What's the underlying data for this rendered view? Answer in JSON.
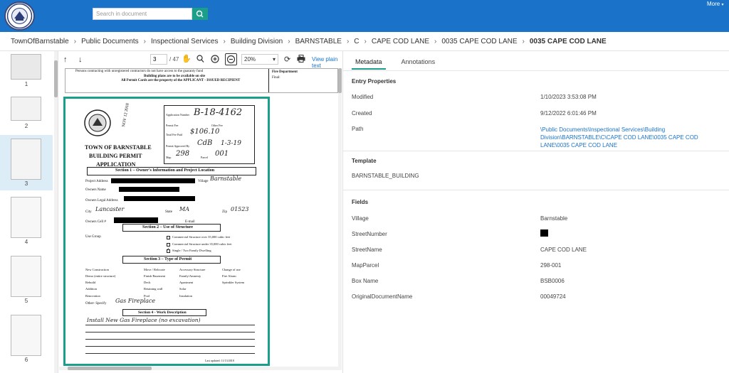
{
  "header": {
    "search_placeholder": "Search in document",
    "more_label": "More",
    "seal_text": "TOWN OF BARNSTABLE"
  },
  "breadcrumbs": [
    "TownOfBarnstable",
    "Public Documents",
    "Inspectional Services",
    "Building Division",
    "BARNSTABLE",
    "C",
    "CAPE COD LANE",
    "0035 CAPE COD LANE",
    "0035 CAPE COD LANE"
  ],
  "thumbnails": [
    "1",
    "2",
    "3",
    "4",
    "5",
    "6"
  ],
  "toolbar": {
    "page_value": "3",
    "page_total": "/ 47",
    "zoom_value": "20%",
    "plain_text_label": "View plain text"
  },
  "page1": {
    "line1": "Persons contracting with unregistered contractors do not have access to the guaranty fund",
    "line2": "Building plans are to be available on site",
    "line3": "All Permit Cards are the property of the APPLICANT - ISSUED RECIPIENT",
    "fire": "Fire Department",
    "final": "Final:"
  },
  "form": {
    "seal": "TOWN OF BARNSTABLE",
    "stamp1": "TOWN OF",
    "stamp2": "BARNSTABLE",
    "stamp3": "NOV 12 2018",
    "title1": "TOWN OF BARNSTABLE",
    "title2": "BUILDING PERMIT",
    "title3": "APPLICATION",
    "app_num_label": "Application Number",
    "app_num": "B-18-4162",
    "permit_fee": "Permit Fee",
    "other_fee": "Other Fee",
    "total_fee_label": "Total Fee Paid",
    "total_fee": "$106.10",
    "approved_label": "Permit Approved By",
    "approved": "CdB",
    "approved_date": "1-3-19",
    "map_label": "Map",
    "map": "298",
    "parcel_label": "Parcel",
    "parcel": "001",
    "s1": "Section 1 – Owner's Information and Project Location",
    "project_addr": "Project Address",
    "village_label": "Village",
    "village": "Barnstable",
    "owners_name": "Owners Name",
    "owners_legal": "Owners Legal Address",
    "city_label": "City",
    "city": "Lancaster",
    "state_label": "State",
    "state": "MA",
    "zip_label": "Zip",
    "zip": "01523",
    "cell_label": "Owners Cell #",
    "email_label": "E-mail",
    "s2": "Section 2 – Use of Structure",
    "use_group": "Use Group",
    "use1": "Commercial Structure over 35,000 cubic feet",
    "use2": "Commercial Structure under 35,000 cubic feet",
    "use3": "Single / Two Family Dwelling",
    "s3": "Section 3 – Type of Permit",
    "types": [
      "New Construction",
      "Move / Relocate",
      "Accessory Structure",
      "Change of use",
      "Demo (entire structure)",
      "Finish Basement",
      "Family/Amnesty",
      "Fire Alarm",
      "Rebuild",
      "Deck",
      "Apartment",
      "Sprinkler System",
      "Addition",
      "Retaining wall",
      "Solar",
      "Renovation",
      "Pool",
      "Insulation"
    ],
    "other_label": "Other- Specify",
    "other_value": "Gas Fireplace",
    "s4": "Section 4 - Work Description",
    "work": "Install New Gas Fireplace (no excavation)",
    "footer": "Last updated: 11/13/2018"
  },
  "panel": {
    "tabs": [
      "Metadata",
      "Annotations"
    ],
    "entry_heading": "Entry Properties",
    "modified_label": "Modified",
    "modified_value": "1/10/2023 3:53:08 PM",
    "created_label": "Created",
    "created_value": "9/12/2022 6:01:46 PM",
    "path_label": "Path",
    "path_value": "\\Public Documents\\Inspectional Services\\Building Division\\BARNSTABLE\\C\\CAPE COD LANE\\0035 CAPE COD LANE\\0035 CAPE COD LANE",
    "template_heading": "Template",
    "template_value": "BARNSTABLE_BUILDING",
    "fields_heading": "Fields",
    "fields": [
      {
        "label": "Village",
        "value": "Barnstable"
      },
      {
        "label": "StreetNumber",
        "value": ""
      },
      {
        "label": "StreetName",
        "value": "CAPE COD LANE"
      },
      {
        "label": "MapParcel",
        "value": "298-001"
      },
      {
        "label": "Box Name",
        "value": "BSB0006"
      },
      {
        "label": "OriginalDocumentName",
        "value": "00049724"
      }
    ]
  },
  "colors": {
    "header_blue": "#1a73c9",
    "accent_teal": "#1b9e8a",
    "link_blue": "#1a73c9"
  }
}
